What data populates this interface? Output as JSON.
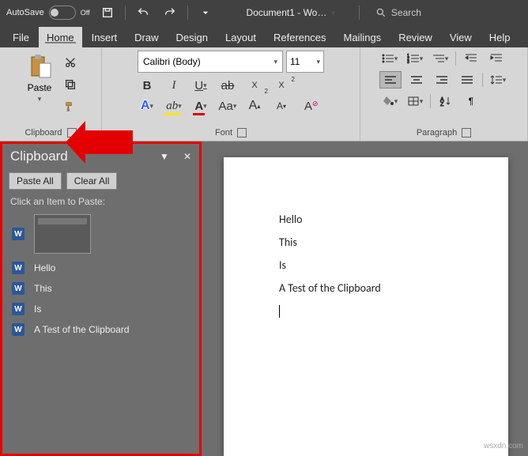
{
  "titlebar": {
    "autosave_label": "AutoSave",
    "autosave_state": "Off",
    "doc_title": "Document1 - Wo…",
    "search_placeholder": "Search"
  },
  "menus": [
    "File",
    "Home",
    "Insert",
    "Draw",
    "Design",
    "Layout",
    "References",
    "Mailings",
    "Review",
    "View",
    "Help"
  ],
  "active_menu": "Home",
  "ribbon": {
    "clipboard": {
      "label": "Clipboard",
      "paste": "Paste"
    },
    "font": {
      "label": "Font",
      "family": "Calibri (Body)",
      "size": "11",
      "case": "Aa",
      "grow": "A",
      "shrink": "A"
    },
    "paragraph": {
      "label": "Paragraph"
    }
  },
  "clipboard_pane": {
    "title": "Clipboard",
    "paste_all": "Paste All",
    "clear_all": "Clear All",
    "hint": "Click an Item to Paste:",
    "items": [
      "Hello",
      "This",
      "Is",
      "A Test of the Clipboard"
    ]
  },
  "document": {
    "lines": [
      "Hello",
      "This",
      "Is",
      "A Test of the Clipboard"
    ]
  },
  "watermark": "wsxdn.com"
}
